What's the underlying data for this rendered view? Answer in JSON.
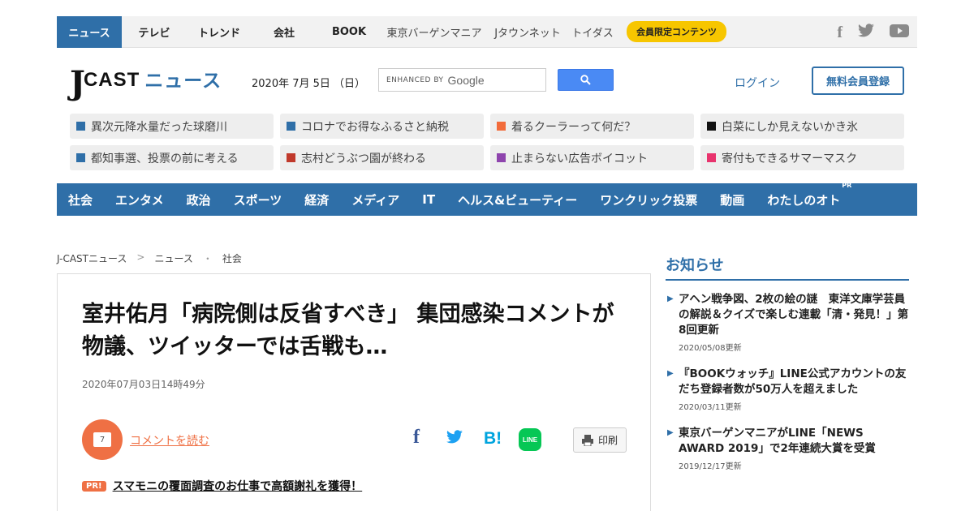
{
  "topbar": {
    "items": [
      "ニュース",
      "テレビ",
      "トレンド",
      "会社",
      "BOOK",
      "東京バーゲンマニア",
      "Jタウンネット",
      "トイダス"
    ],
    "member_badge": "会員限定コンテンツ",
    "social": [
      "facebook-icon",
      "twitter-icon",
      "youtube-icon"
    ]
  },
  "header": {
    "logo_j": "J",
    "logo_cast": "CAST",
    "logo_news": "ニュース",
    "date": "2020年 7月 5日 （日）",
    "search_enhanced": "ENHANCED BY",
    "search_google": "Google",
    "login": "ログイン",
    "register": "無料会員登録"
  },
  "topics": [
    {
      "label": "異次元降水量だった球磨川",
      "color": "#2f6fa8"
    },
    {
      "label": "コロナでお得なふるさと納税",
      "color": "#2f6fa8"
    },
    {
      "label": "着るクーラーって何だ？",
      "color": "#f26b3a"
    },
    {
      "label": "白菜にしか見えないかき氷",
      "color": "#111111"
    },
    {
      "label": "都知事選、投票の前に考える",
      "color": "#2f6fa8"
    },
    {
      "label": "志村どうぶつ園が終わる",
      "color": "#c0392b"
    },
    {
      "label": "止まらない広告ボイコット",
      "color": "#8e44ad"
    },
    {
      "label": "寄付もできるサマーマスク",
      "color": "#e8336d"
    }
  ],
  "nav": {
    "items": [
      "社会",
      "エンタメ",
      "政治",
      "スポーツ",
      "経済",
      "メディア",
      "IT",
      "ヘルス&ビューティー",
      "ワンクリック投票",
      "動画",
      "わたしのオト"
    ],
    "pr_label": "PR"
  },
  "breadcrumb": {
    "items": [
      "J-CASTニュース",
      "ニュース",
      "社会"
    ],
    "sep1": ">",
    "sep2": "・"
  },
  "article": {
    "title": "室井佑月「病院側は反省すべき」 集団感染コメントが物議、ツイッターでは舌戦も…",
    "date": "2020年07月03日14時49分",
    "comment_count": "7",
    "comment_link": "コメントを読む",
    "share_fb": "f",
    "share_tw": "🐦",
    "share_hb": "B!",
    "share_line": "LINE",
    "print": "印刷",
    "pr_badge": "PR!",
    "pr_link": "スマモニの覆面調査のお仕事で高額謝礼を獲得！"
  },
  "sidebar": {
    "title": "お知らせ",
    "items": [
      {
        "text": "アヘン戦争図、2枚の絵の謎　東洋文庫学芸員の解説＆クイズで楽しむ連載「清・発見！」第8回更新",
        "date": "2020/05/08更新"
      },
      {
        "text": "『BOOKウォッチ』LINE公式アカウントの友だち登録者数が50万人を超えました",
        "date": "2020/03/11更新"
      },
      {
        "text": "東京バーゲンマニアがLINE「NEWS AWARD 2019」で2年連続大賞を受賞",
        "date": "2019/12/17更新"
      }
    ]
  },
  "colors": {
    "brand": "#2f6fa8",
    "accent": "#ef7044",
    "badge": "#f7c600"
  }
}
